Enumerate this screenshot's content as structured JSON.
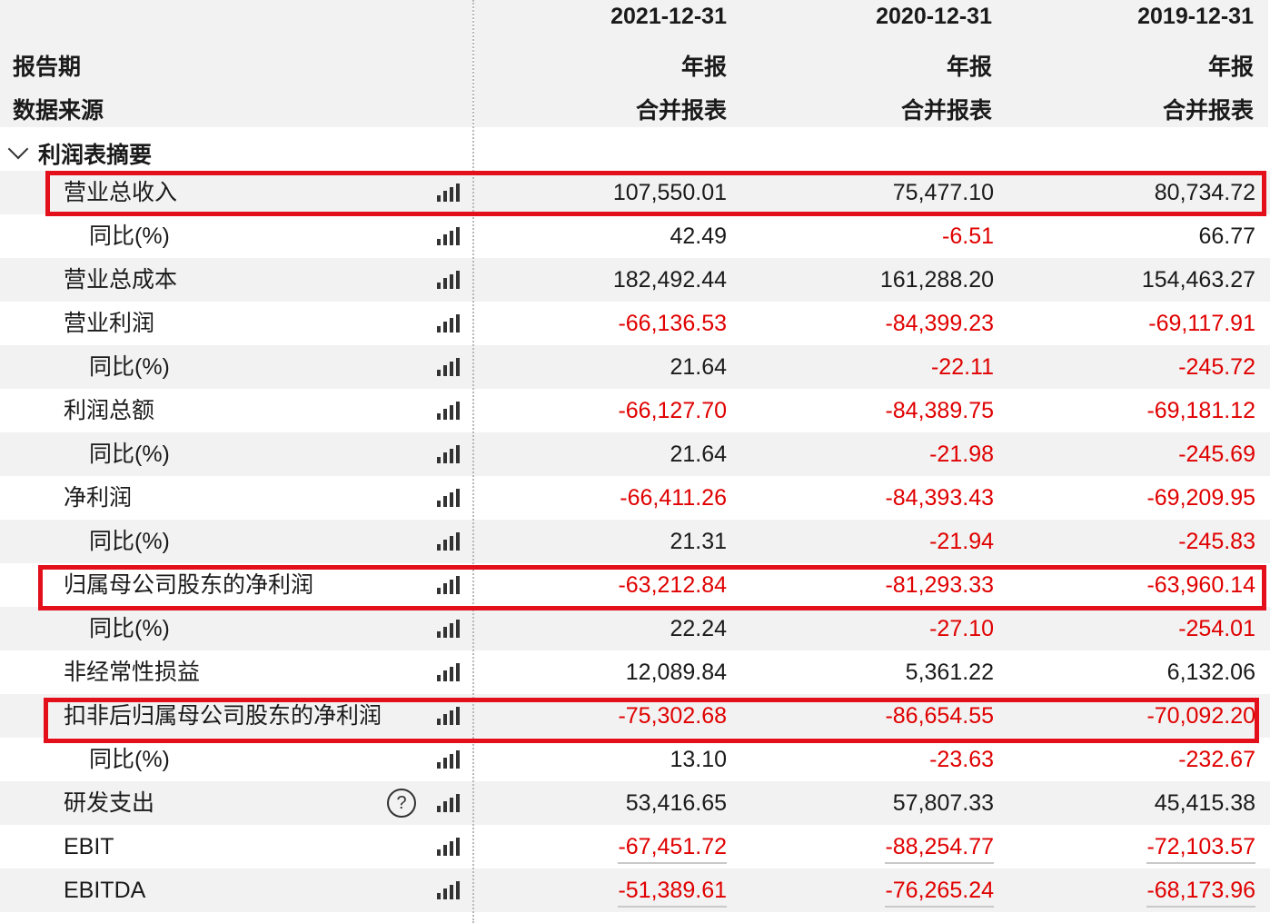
{
  "header": {
    "periods": [
      "2021-12-31",
      "2020-12-31",
      "2019-12-31"
    ],
    "report_period_label": "报告期",
    "report_types": [
      "年报",
      "年报",
      "年报"
    ],
    "data_source_label": "数据来源",
    "data_sources": [
      "合并报表",
      "合并报表",
      "合并报表"
    ]
  },
  "section": {
    "title": "利润表摘要",
    "icon": "chevron-down-icon"
  },
  "rows": [
    {
      "label": "营业总收入",
      "v": [
        "107,550.01",
        "75,477.10",
        "80,734.72"
      ]
    },
    {
      "label": "同比(%)",
      "v": [
        "42.49",
        "-6.51",
        "66.77"
      ]
    },
    {
      "label": "营业总成本",
      "v": [
        "182,492.44",
        "161,288.20",
        "154,463.27"
      ]
    },
    {
      "label": "营业利润",
      "v": [
        "-66,136.53",
        "-84,399.23",
        "-69,117.91"
      ]
    },
    {
      "label": "同比(%)",
      "v": [
        "21.64",
        "-22.11",
        "-245.72"
      ]
    },
    {
      "label": "利润总额",
      "v": [
        "-66,127.70",
        "-84,389.75",
        "-69,181.12"
      ]
    },
    {
      "label": "同比(%)",
      "v": [
        "21.64",
        "-21.98",
        "-245.69"
      ]
    },
    {
      "label": "净利润",
      "v": [
        "-66,411.26",
        "-84,393.43",
        "-69,209.95"
      ]
    },
    {
      "label": "同比(%)",
      "v": [
        "21.31",
        "-21.94",
        "-245.83"
      ]
    },
    {
      "label": "归属母公司股东的净利润",
      "v": [
        "-63,212.84",
        "-81,293.33",
        "-63,960.14"
      ]
    },
    {
      "label": "同比(%)",
      "v": [
        "22.24",
        "-27.10",
        "-254.01"
      ]
    },
    {
      "label": "非经常性损益",
      "v": [
        "12,089.84",
        "5,361.22",
        "6,132.06"
      ]
    },
    {
      "label": "扣非后归属母公司股东的净利润",
      "v": [
        "-75,302.68",
        "-86,654.55",
        "-70,092.20"
      ]
    },
    {
      "label": "同比(%)",
      "v": [
        "13.10",
        "-23.63",
        "-232.67"
      ]
    },
    {
      "label": "研发支出",
      "v": [
        "53,416.65",
        "57,807.33",
        "45,415.38"
      ]
    },
    {
      "label": "EBIT",
      "v": [
        "-67,451.72",
        "-88,254.77",
        "-72,103.57"
      ]
    },
    {
      "label": "EBITDA",
      "v": [
        "-51,389.61",
        "-76,265.24",
        "-68,173.96"
      ]
    }
  ],
  "icons": {
    "chart": "bar-chart-icon",
    "help": "help-icon"
  },
  "help_glyph": "?",
  "colors": {
    "negative": "#e00000",
    "highlight": "#e3101c",
    "stripe": "#f2f2f2"
  }
}
